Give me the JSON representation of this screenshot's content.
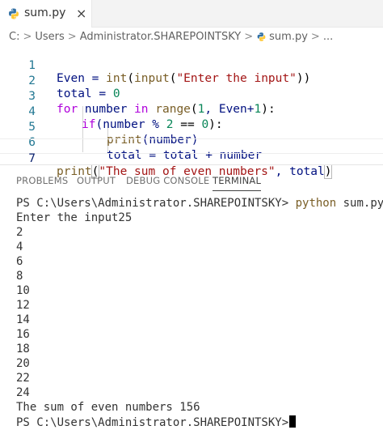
{
  "tab": {
    "label": "sum.py",
    "close_glyph": "×",
    "icon": "python-file-icon"
  },
  "breadcrumb": {
    "items": [
      "C:",
      "Users",
      "Administrator.SHAREPOINTSKY",
      "sum.py",
      "..."
    ],
    "separator": ">"
  },
  "editor": {
    "lines": [
      {
        "number": "1"
      },
      {
        "number": "2"
      },
      {
        "number": "3"
      },
      {
        "number": "4"
      },
      {
        "number": "5"
      },
      {
        "number": "6"
      },
      {
        "number": "7"
      }
    ],
    "tokens": {
      "l1": [
        "Even = ",
        "int",
        "(",
        "input",
        "(",
        "\"Enter the input\"",
        "))"
      ],
      "l2": [
        "total = ",
        "0"
      ],
      "l3": [
        "for",
        " number ",
        "in",
        " ",
        "range",
        "(",
        "1",
        ", Even+",
        "1",
        "):"
      ],
      "l4": [
        "if",
        "(number % ",
        "2",
        " == ",
        "0",
        "):"
      ],
      "l5": [
        "print",
        "(number)"
      ],
      "l6": [
        "total = total + number"
      ],
      "l7": [
        "print",
        "(",
        "\"The sum of even numbers\"",
        ", total",
        ")"
      ]
    }
  },
  "panel": {
    "tabs": [
      "PROBLEMS",
      "OUTPUT",
      "DEBUG CONSOLE",
      "TERMINAL"
    ],
    "active_tab": "TERMINAL"
  },
  "terminal": {
    "prompt": "PS C:\\Users\\Administrator.SHAREPOINTSKY>",
    "command_keyword": "python",
    "command_arg": "sum.py",
    "input_line": "Enter the input25",
    "outputs": [
      "2",
      "4",
      "6",
      "8",
      "10",
      "12",
      "14",
      "16",
      "18",
      "20",
      "22",
      "24"
    ],
    "result_line": "The sum of even numbers 156",
    "final_prompt": "PS C:\\Users\\Administrator.SHAREPOINTSKY>"
  },
  "colors": {
    "keyword_blue": "#0000ff",
    "control_purple": "#af00db",
    "number_green": "#098658",
    "string_red": "#a31515",
    "function_brown": "#795e26",
    "line_number": "#237893"
  }
}
